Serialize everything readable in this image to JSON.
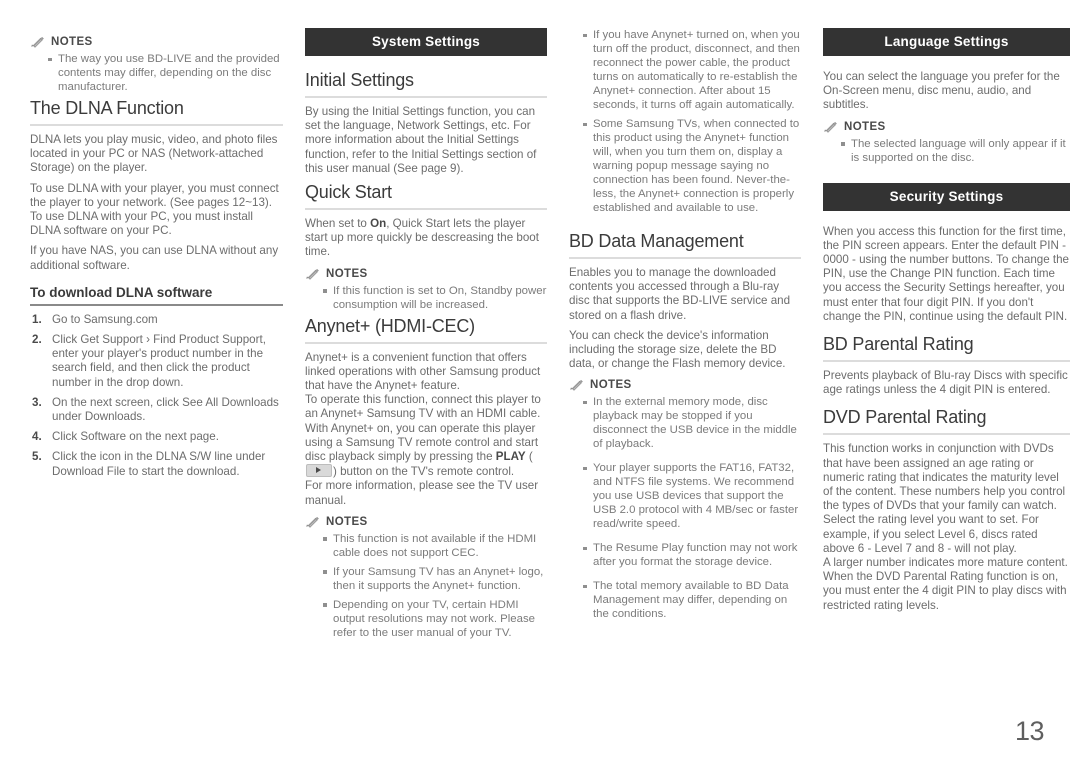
{
  "page": {
    "number": "13",
    "notes_label": "NOTES",
    "pencil_icon": "pencil-icon"
  },
  "column1": {
    "notes_top": {
      "label": "NOTES",
      "items": [
        "The way you use BD-LIVE and the provided contents may differ, depending on the disc manufacturer."
      ]
    },
    "dlna": {
      "heading": "The DLNA Function",
      "paragraphs": [
        "DLNA lets you play music, video, and photo files located in your PC or NAS (Network-attached Storage) on the player.",
        "To use DLNA with your player, you must connect the player to your network. (See pages 12~13).",
        "To use DLNA with your PC, you must install DLNA software on your PC.",
        "If you have NAS, you can use DLNA without any additional software."
      ]
    },
    "download": {
      "heading": "To download DLNA software",
      "steps": [
        "Go to Samsung.com",
        "Click Get Support › Find Product Support, enter your player's product number in the search field, and then click the product number in the drop down.",
        "On the next screen, click See All Downloads under Downloads.",
        "Click Software on the next page.",
        "Click the icon in the DLNA S/W line under Download File to start the download."
      ]
    }
  },
  "column2": {
    "banner": "System Settings",
    "initial_settings": {
      "heading": "Initial Settings",
      "paragraphs": [
        "By using the Initial Settings function, you can set the language, Network Settings, etc. For more information about the Initial Settings function, refer to the Initial Settings section of this user manual (See page 9)."
      ]
    },
    "quick_start": {
      "heading": "Quick Start",
      "paragraph_prefix": "When set to ",
      "paragraph_bold": "On",
      "paragraph_suffix": ", Quick Start lets the player start up more quickly be descreasing the boot time.",
      "notes": {
        "label": "NOTES",
        "items": [
          "If this function is set to On, Standby power consumption will be increased."
        ]
      }
    },
    "anynet": {
      "heading": "Anynet+ (HDMI-CEC)",
      "para1": "Anynet+ is a convenient function that offers linked operations with other Samsung product that have the Anynet+ feature.",
      "para2_a": "To operate this function, connect this player to an Anynet+ Samsung TV with an HDMI cable. With Anynet+ on, you can operate this player using a Samsung TV remote control and start disc playback simply by pressing the ",
      "para2_bold": "PLAY",
      "para2_open": " (",
      "play_icon": "play-button-icon",
      "para2_close": ") button on the TV's remote control.",
      "para3": "For more information, please see the TV user manual.",
      "notes": {
        "label": "NOTES",
        "items": [
          "This function is not available if the HDMI cable does not support CEC.",
          "If your Samsung TV has an Anynet+ logo, then it supports the Anynet+ function.",
          "Depending on your TV, certain HDMI output resolutions may not work. Please refer to the user manual of your TV."
        ]
      }
    }
  },
  "column3": {
    "notes_top": {
      "items": [
        "If you have Anynet+ turned on, when you turn off the product, disconnect, and then reconnect the power cable, the product turns on automatically to re-establish the Anynet+ connection. After about 15 seconds, it turns off again automatically.",
        "Some Samsung TVs, when connected to this product using the Anynet+ function will, when you turn them on, display a warning popup message saying no connection has been found. Never-the-less, the Anynet+ connection is properly established and available to use."
      ]
    },
    "bd_data": {
      "heading": "BD Data Management",
      "paragraphs": [
        "Enables you to manage the downloaded contents you accessed through a Blu-ray disc that supports the BD-LIVE service and stored on a flash drive.",
        "You can check the device's information including the storage size, delete the BD data, or change the Flash memory device."
      ],
      "notes": {
        "label": "NOTES",
        "items": [
          "In the external memory mode, disc playback may be stopped if you disconnect the USB device in the middle of playback.",
          "Your player supports the FAT16, FAT32, and NTFS file systems. We recommend you use USB devices that support the USB 2.0 protocol with 4 MB/sec or faster read/write speed.",
          "The Resume Play function may not work after you format the storage device.",
          "The total memory available to BD Data Management may differ, depending on the conditions."
        ]
      }
    }
  },
  "column4": {
    "language_banner": "Language Settings",
    "language": {
      "paragraphs": [
        "You can select the language you prefer for the On-Screen menu, disc menu, audio, and subtitles."
      ],
      "notes": {
        "label": "NOTES",
        "items": [
          "The selected language will only appear if it is supported on the disc."
        ]
      }
    },
    "security_banner": "Security Settings",
    "security": {
      "paragraphs": [
        "When you access this function for the first time, the PIN screen appears. Enter the default PIN - 0000 - using the number buttons. To change the PIN, use the Change PIN function. Each time you access the Security Settings hereafter, you must enter that four digit PIN. If you don't change the PIN, continue using the default PIN."
      ]
    },
    "bd_parental": {
      "heading": "BD Parental Rating",
      "paragraphs": [
        "Prevents playback of Blu-ray Discs with specific age ratings unless the 4 digit PIN is entered."
      ]
    },
    "dvd_parental": {
      "heading": "DVD Parental Rating",
      "paragraphs": [
        "This function works in conjunction with DVDs that have been assigned an age rating or numeric rating that indicates the maturity level of the content. These numbers help you control the types of DVDs that your family can watch.",
        "Select the rating level you want to set. For example, if you select Level 6, discs rated above 6 - Level 7 and 8 - will not play.",
        "A larger number indicates more mature content.",
        "When the DVD Parental Rating function is on, you must enter the 4 digit PIN to play discs with restricted rating levels."
      ]
    }
  }
}
